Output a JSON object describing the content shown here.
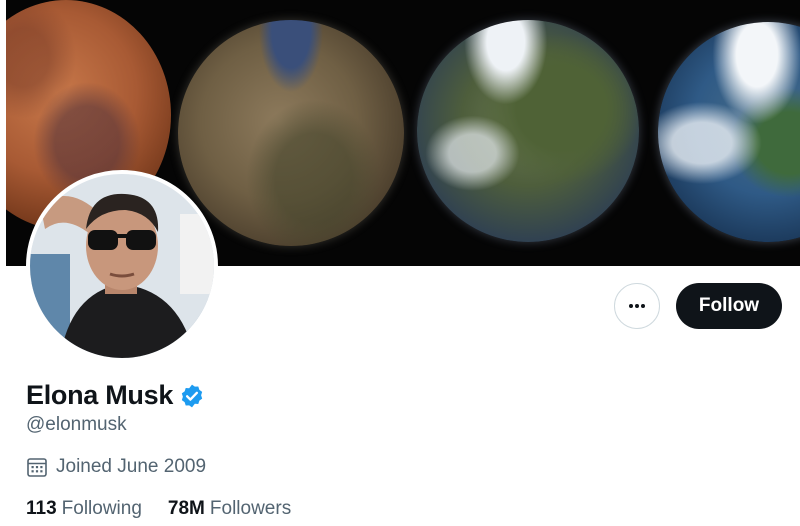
{
  "profile": {
    "display_name": "Elona Musk",
    "handle": "@elonmusk",
    "joined": "Joined June 2009",
    "verified": true
  },
  "actions": {
    "follow_label": "Follow"
  },
  "stats": [
    {
      "count": "113",
      "label": "Following"
    },
    {
      "count": "78M",
      "label": "Followers"
    }
  ],
  "icons": {
    "more": "more-horizontal-icon",
    "verified": "verified-badge-icon",
    "calendar": "calendar-icon"
  },
  "colors": {
    "follow_bg": "#0f1419",
    "verified_blue": "#1d9bf0",
    "secondary_text": "#536471"
  }
}
